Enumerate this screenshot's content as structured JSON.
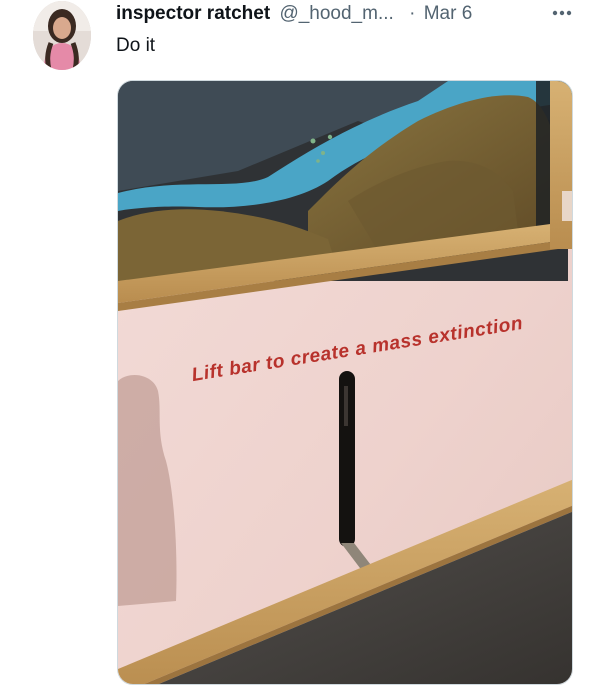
{
  "tweet": {
    "author_name": "inspector ratchet",
    "author_handle": "@_hood_m...",
    "separator": "·",
    "timestamp": "Mar 6",
    "text": "Do it",
    "avatar_icon": "user-avatar",
    "more_icon": "more-horizontal-icon"
  },
  "media": {
    "sign_text": "Lift bar to create a mass extinction"
  },
  "colors": {
    "text_primary": "#0f1419",
    "text_secondary": "#536471",
    "sign_text": "#b8322c",
    "wall": "#efd6d3",
    "wood_frame": "#c9a063"
  }
}
